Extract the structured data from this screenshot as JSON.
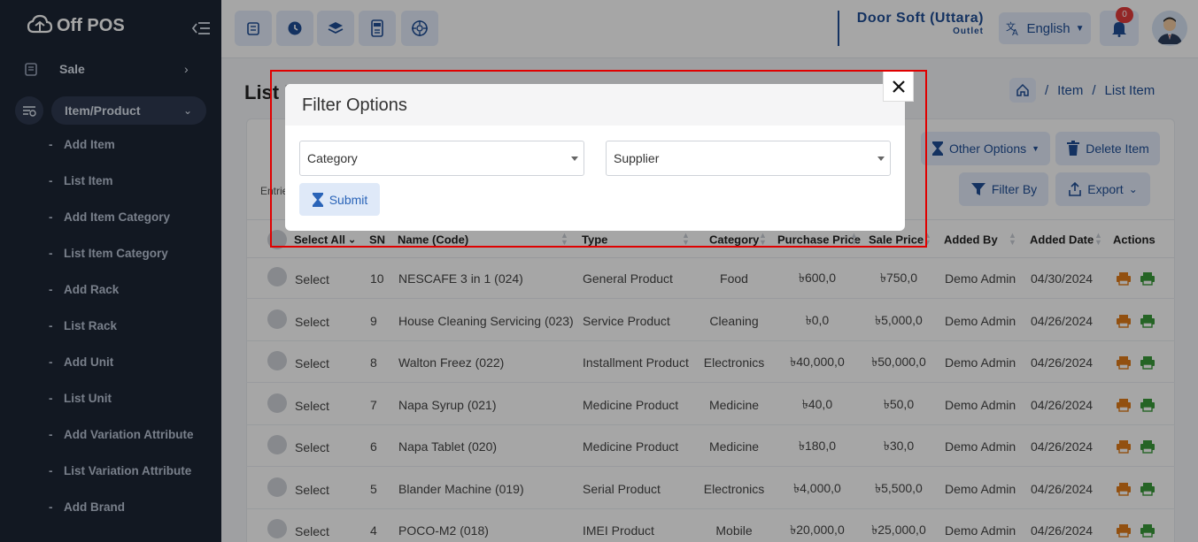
{
  "app": {
    "logo_text": "Off POS"
  },
  "sidebar": {
    "items": [
      {
        "label": "Sale",
        "icon": "cart-icon"
      },
      {
        "label": "Item/Product",
        "icon": "list-filter-icon"
      }
    ],
    "sub_items": [
      "Add Item",
      "List Item",
      "Add Item Category",
      "List Item Category",
      "Add Rack",
      "List Rack",
      "Add Unit",
      "List Unit",
      "Add Variation Attribute",
      "List Variation Attribute",
      "Add Brand"
    ],
    "dash": "-"
  },
  "topbar": {
    "outlet_name": "Door Soft (Uttara)",
    "outlet_sub": "Outlet",
    "language": "English",
    "notification_count": "0"
  },
  "page": {
    "title": "List Item",
    "breadcrumb": [
      "Item",
      "List Item"
    ],
    "breadcrumb_sep": "/"
  },
  "toolbar": {
    "other_options": "Other Options",
    "delete_item": "Delete Item",
    "filter_by": "Filter By",
    "export": "Export",
    "entries_label": "Entries"
  },
  "table": {
    "headers": [
      "Select All",
      "SN",
      "Name (Code)",
      "Type",
      "Category",
      "Purchase Price",
      "Sale Price",
      "Added By",
      "Added Date",
      "Actions"
    ],
    "select_label": "Select",
    "rows": [
      {
        "sn": "10",
        "name": "NESCAFE 3 in 1 (024)",
        "type": "General Product",
        "category": "Food",
        "purchase": "৳600,0",
        "sale": "৳750,0",
        "added_by": "Demo Admin",
        "date": "04/30/2024"
      },
      {
        "sn": "9",
        "name": "House Cleaning Servicing (023)",
        "type": "Service Product",
        "category": "Cleaning",
        "purchase": "৳0,0",
        "sale": "৳5,000,0",
        "added_by": "Demo Admin",
        "date": "04/26/2024"
      },
      {
        "sn": "8",
        "name": "Walton Freez (022)",
        "type": "Installment Product",
        "category": "Electronics",
        "purchase": "৳40,000,0",
        "sale": "৳50,000,0",
        "added_by": "Demo Admin",
        "date": "04/26/2024"
      },
      {
        "sn": "7",
        "name": "Napa Syrup (021)",
        "type": "Medicine Product",
        "category": "Medicine",
        "purchase": "৳40,0",
        "sale": "৳50,0",
        "added_by": "Demo Admin",
        "date": "04/26/2024"
      },
      {
        "sn": "6",
        "name": "Napa Tablet (020)",
        "type": "Medicine Product",
        "category": "Medicine",
        "purchase": "৳180,0",
        "sale": "৳30,0",
        "added_by": "Demo Admin",
        "date": "04/26/2024"
      },
      {
        "sn": "5",
        "name": "Blander Machine (019)",
        "type": "Serial Product",
        "category": "Electronics",
        "purchase": "৳4,000,0",
        "sale": "৳5,500,0",
        "added_by": "Demo Admin",
        "date": "04/26/2024"
      },
      {
        "sn": "4",
        "name": "POCO-M2 (018)",
        "type": "IMEI Product",
        "category": "Mobile",
        "purchase": "৳20,000,0",
        "sale": "৳25,000,0",
        "added_by": "Demo Admin",
        "date": "04/26/2024"
      }
    ]
  },
  "modal": {
    "title": "Filter Options",
    "category_select": "Category",
    "supplier_select": "Supplier",
    "submit_label": "Submit"
  },
  "colors": {
    "sidebar_bg": "#1d2535",
    "brand_blue": "#1f4e96",
    "print_icon": "#e07b1a",
    "barcode_icon": "#3a9a3a",
    "highlight": "#e00000"
  }
}
